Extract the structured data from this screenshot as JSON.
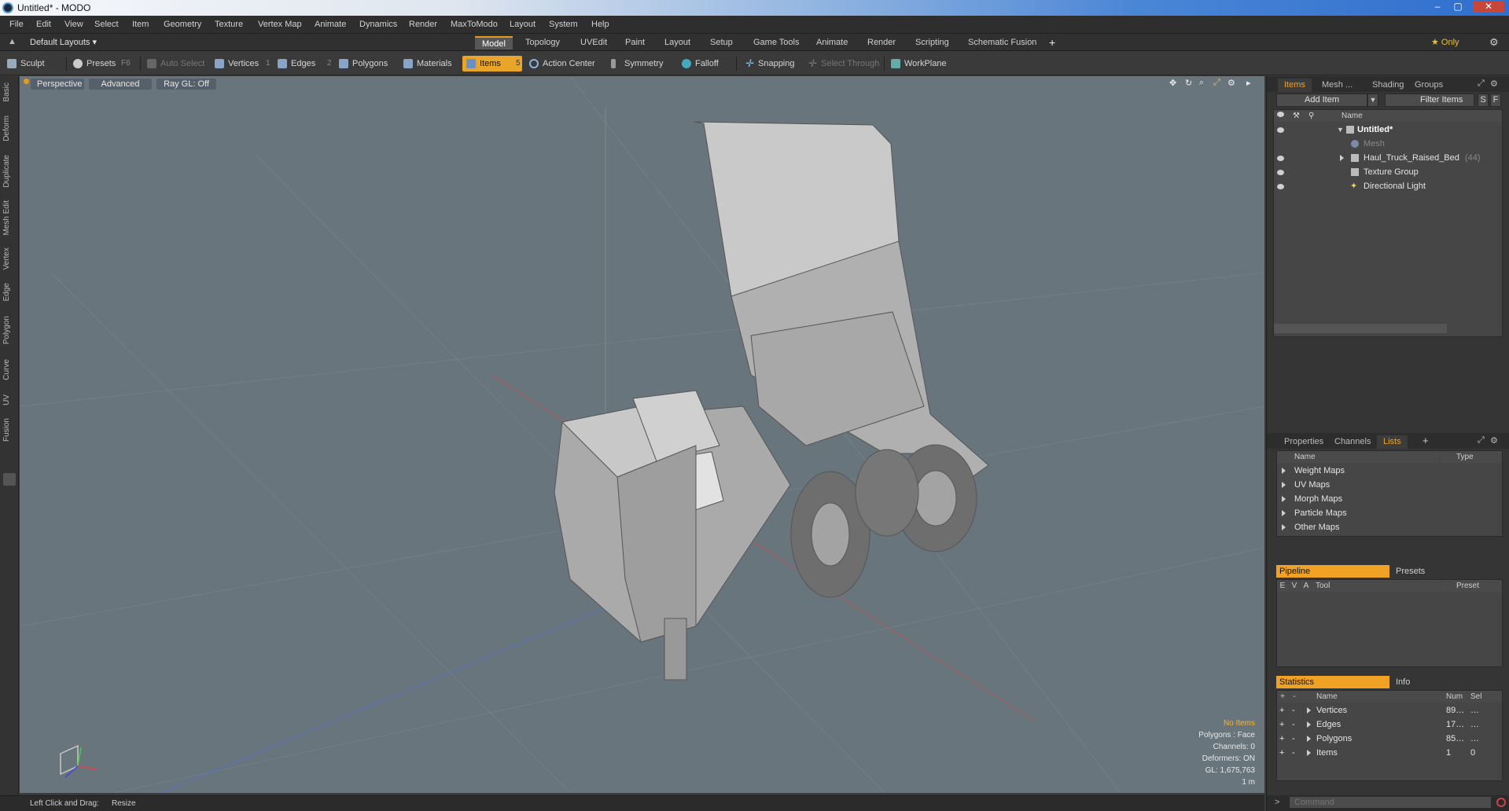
{
  "window": {
    "title": "Untitled* - MODO",
    "min": "–",
    "max": "▢",
    "close": "✕"
  },
  "menu": [
    "File",
    "Edit",
    "View",
    "Select",
    "Item",
    "Geometry",
    "Texture",
    "Vertex Map",
    "Animate",
    "Dynamics",
    "Render",
    "MaxToModo",
    "Layout",
    "System",
    "Help"
  ],
  "layout_selector": "Default Layouts ▾",
  "layout_tabs": [
    "Model",
    "Topology",
    "UVEdit",
    "Paint",
    "Layout",
    "Setup",
    "Game Tools",
    "Animate",
    "Render",
    "Scripting",
    "Schematic Fusion"
  ],
  "layout_add": "+",
  "only_label": "★ Only",
  "toolbar": {
    "sculpt": "Sculpt",
    "presets": "Presets",
    "presets_key": "F6",
    "auto_select": "Auto Select",
    "vertices": "Vertices",
    "vertices_key": "1",
    "edges": "Edges",
    "edges_key": "2",
    "polygons": "Polygons",
    "materials": "Materials",
    "items": "Items",
    "items_key": "5",
    "action_center": "Action Center",
    "symmetry": "Symmetry",
    "falloff": "Falloff",
    "snapping": "Snapping",
    "select_through": "Select Through",
    "workplane": "WorkPlane"
  },
  "left_tabs": [
    "Basic",
    "Deform",
    "Duplicate",
    "Mesh Edit",
    "Vertex",
    "Edge",
    "Polygon",
    "Curve",
    "UV",
    "Fusion"
  ],
  "viewport": {
    "view": "Perspective",
    "mode": "Advanced",
    "render": "Ray GL: Off",
    "info": {
      "selection": "No Items",
      "polygons": "Polygons : Face",
      "channels": "Channels: 0",
      "deformers": "Deformers: ON",
      "gl": "GL: 1,675,763",
      "scale": "1 m"
    }
  },
  "items_panel": {
    "tabs": [
      "Items",
      "Mesh ...",
      "Shading",
      "Groups"
    ],
    "add_item": "Add Item",
    "filter": "Filter Items",
    "btn_s": "S",
    "btn_f": "F",
    "col_name": "Name",
    "tree": [
      {
        "label": "Untitled*",
        "bold": true
      },
      {
        "label": "Mesh",
        "dim": true
      },
      {
        "label": "Haul_Truck_Raised_Bed",
        "count": "(44)"
      },
      {
        "label": "Texture Group"
      },
      {
        "label": "Directional Light"
      }
    ]
  },
  "lists_panel": {
    "tabs": [
      "Properties",
      "Channels",
      "Lists"
    ],
    "add": "+",
    "col_name": "Name",
    "col_type": "Type",
    "rows": [
      "Weight Maps",
      "UV Maps",
      "Morph Maps",
      "Particle Maps",
      "Other Maps"
    ]
  },
  "pipeline_panel": {
    "tab_on": "Pipeline",
    "tab_off": "Presets",
    "cols": [
      "E",
      "V",
      "A",
      "Tool",
      "Preset"
    ]
  },
  "stats_panel": {
    "tab_on": "Statistics",
    "tab_off": "Info",
    "plus": "+",
    "minus": "-",
    "cols": [
      "Name",
      "Num",
      "Sel"
    ],
    "rows": [
      {
        "name": "Vertices",
        "num": "89…",
        "sel": "…"
      },
      {
        "name": "Edges",
        "num": "17…",
        "sel": "…"
      },
      {
        "name": "Polygons",
        "num": "85…",
        "sel": "…"
      },
      {
        "name": "Items",
        "num": "1",
        "sel": "0"
      }
    ]
  },
  "status": {
    "hint": "Left Click and Drag:",
    "action": "Resize"
  },
  "command": {
    "placeholder": "Command",
    "prompt": ">"
  }
}
